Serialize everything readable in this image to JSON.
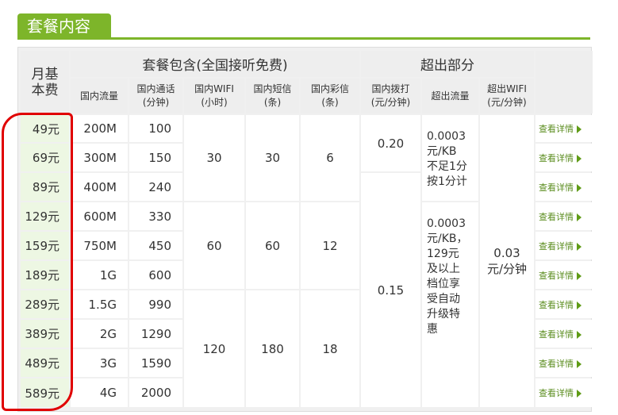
{
  "section_title": "套餐内容",
  "header": {
    "monthly_fee": "月基\n本费",
    "included": "套餐包含(全国接听免费)",
    "overage": "超出部分",
    "cols": [
      "国内流量",
      "国内通话\n(分钟)",
      "国内WIFI\n(小时)",
      "国内短信\n(条)",
      "国内彩信\n(条)",
      "国内拨打\n(元/分钟)",
      "超出流量",
      "超出WIFI\n(元/分钟)"
    ]
  },
  "rows": [
    {
      "fee": "49元",
      "traffic": "200M",
      "minutes": "100",
      "detail": "查看详情"
    },
    {
      "fee": "69元",
      "traffic": "300M",
      "minutes": "150",
      "detail": "查看详情"
    },
    {
      "fee": "89元",
      "traffic": "400M",
      "minutes": "240",
      "detail": "查看详情"
    },
    {
      "fee": "129元",
      "traffic": "600M",
      "minutes": "330",
      "detail": "查看详情"
    },
    {
      "fee": "159元",
      "traffic": "750M",
      "minutes": "450",
      "detail": "查看详情"
    },
    {
      "fee": "189元",
      "traffic": "1G",
      "minutes": "600",
      "detail": "查看详情"
    },
    {
      "fee": "289元",
      "traffic": "1.5G",
      "minutes": "990",
      "detail": "查看详情"
    },
    {
      "fee": "389元",
      "traffic": "2G",
      "minutes": "1290",
      "detail": "查看详情"
    },
    {
      "fee": "489元",
      "traffic": "3G",
      "minutes": "1590",
      "detail": "查看详情"
    },
    {
      "fee": "589元",
      "traffic": "4G",
      "minutes": "2000",
      "detail": "查看详情"
    }
  ],
  "groups": {
    "wifi": [
      "30",
      "60",
      "120"
    ],
    "sms": [
      "30",
      "60",
      "180"
    ],
    "mms": [
      "6",
      "12",
      "18"
    ]
  },
  "call_rate": [
    "0.20",
    "0.15"
  ],
  "overage_traffic": [
    "0.0003\n元/KB\n不足1分\n按1分计",
    "0.0003\n元/KB，\n129元\n及以上\n档位享\n受自动\n升级特\n惠"
  ],
  "overage_wifi": "0.03\n元/分钟"
}
